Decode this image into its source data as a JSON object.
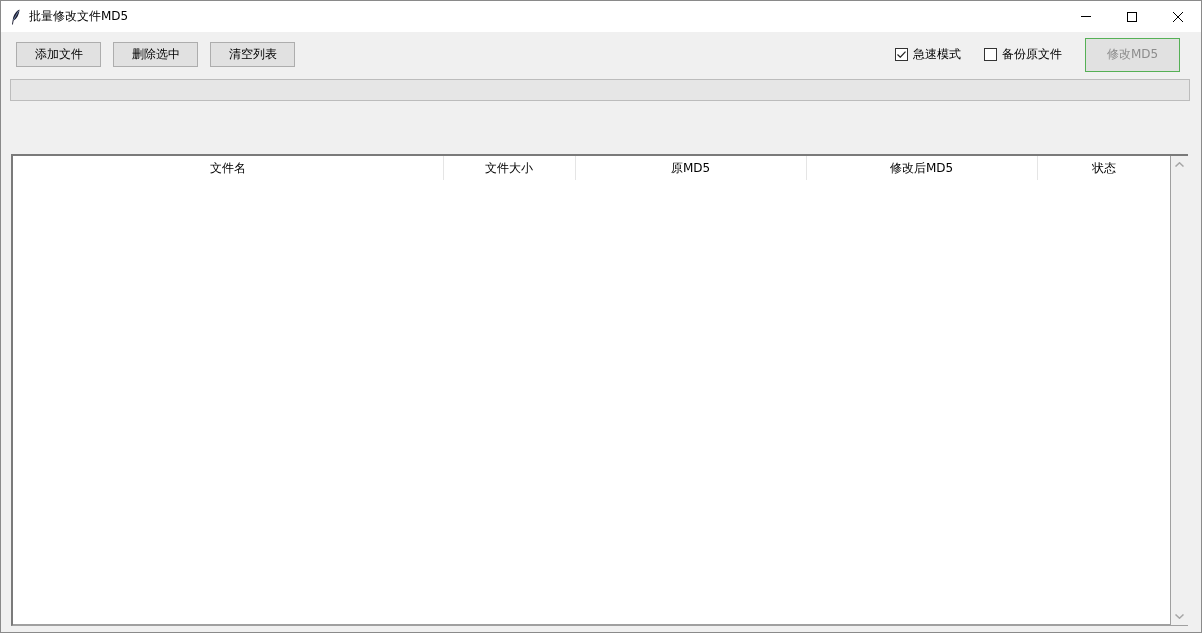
{
  "window": {
    "title": "批量修改文件MD5"
  },
  "toolbar": {
    "buttons": [
      {
        "label": "添加文件"
      },
      {
        "label": "删除选中"
      },
      {
        "label": "清空列表"
      }
    ],
    "options": [
      {
        "label": "急速模式",
        "checked": true
      },
      {
        "label": "备份原文件",
        "checked": false
      }
    ],
    "run_button": {
      "label": "修改MD5",
      "disabled": true
    }
  },
  "progress": {
    "level": 0
  },
  "table": {
    "columns": [
      "文件名",
      "文件大小",
      "原MD5",
      "修改后MD5",
      "状态"
    ]
  }
}
